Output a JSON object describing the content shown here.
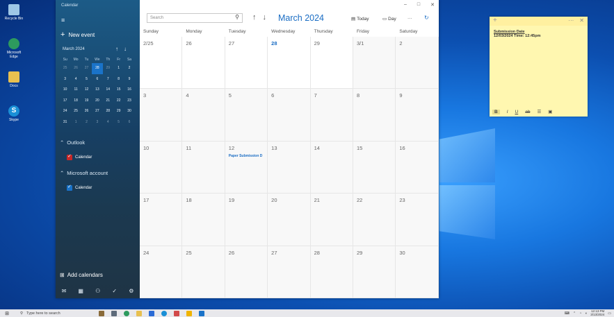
{
  "desktop": {
    "icons": [
      {
        "label": "Recycle Bin",
        "color": "#9ec7e6"
      },
      {
        "label": "Microsoft Edge",
        "color": "#2d9a5e"
      },
      {
        "label": "Docs",
        "color": "#e8c050"
      },
      {
        "label": "Skype",
        "color": "#1a8fd6"
      }
    ]
  },
  "calendar": {
    "sidebar": {
      "app_title": "Calendar",
      "hamburger": "≡",
      "new_event_label": "New event",
      "mini_month": "March 2024",
      "mini_dow": [
        "Su",
        "Mo",
        "Tu",
        "We",
        "Th",
        "Fr",
        "Sa"
      ],
      "mini_days": [
        [
          "25",
          "26",
          "27",
          "28",
          "29",
          "1",
          "2"
        ],
        [
          "3",
          "4",
          "5",
          "6",
          "7",
          "8",
          "9"
        ],
        [
          "10",
          "11",
          "12",
          "13",
          "14",
          "15",
          "16"
        ],
        [
          "17",
          "18",
          "19",
          "20",
          "21",
          "22",
          "23"
        ],
        [
          "24",
          "25",
          "26",
          "27",
          "28",
          "29",
          "30"
        ],
        [
          "31",
          "1",
          "2",
          "3",
          "4",
          "5",
          "6"
        ]
      ],
      "accounts": [
        {
          "name": "Outlook",
          "calendar_label": "Calendar",
          "color": "#c62828"
        },
        {
          "name": "Microsoft account",
          "calendar_label": "Calendar",
          "color": "#1a73c9"
        }
      ],
      "add_calendars_label": "Add calendars"
    },
    "toolbar": {
      "search_placeholder": "Search",
      "month_title": "March 2024",
      "today_label": "Today",
      "day_label": "Day",
      "more": "···"
    },
    "window_controls": {
      "minimize": "–",
      "maximize": "□",
      "close": "✕"
    },
    "weekdays": [
      "Sunday",
      "Monday",
      "Tuesday",
      "Wednesday",
      "Thursday",
      "Friday",
      "Saturday"
    ],
    "weeks": [
      [
        "2/25",
        "26",
        "27",
        "28",
        "29",
        "3/1",
        "2"
      ],
      [
        "3",
        "4",
        "5",
        "6",
        "7",
        "8",
        "9"
      ],
      [
        "10",
        "11",
        "12",
        "13",
        "14",
        "15",
        "16"
      ],
      [
        "17",
        "18",
        "19",
        "20",
        "21",
        "22",
        "23"
      ],
      [
        "24",
        "25",
        "26",
        "27",
        "28",
        "29",
        "30"
      ]
    ],
    "event": {
      "text": "Paper Submission D"
    }
  },
  "sticky_note": {
    "line1": "Submission Date",
    "line2": "12/03/2024 Time: 12:45pm",
    "toolbar": [
      "B",
      "I",
      "U",
      "ab",
      "☰",
      "▣"
    ]
  },
  "taskbar": {
    "search_placeholder": "Type here to search",
    "time": "12:13 PM",
    "date": "3/13/2024"
  }
}
